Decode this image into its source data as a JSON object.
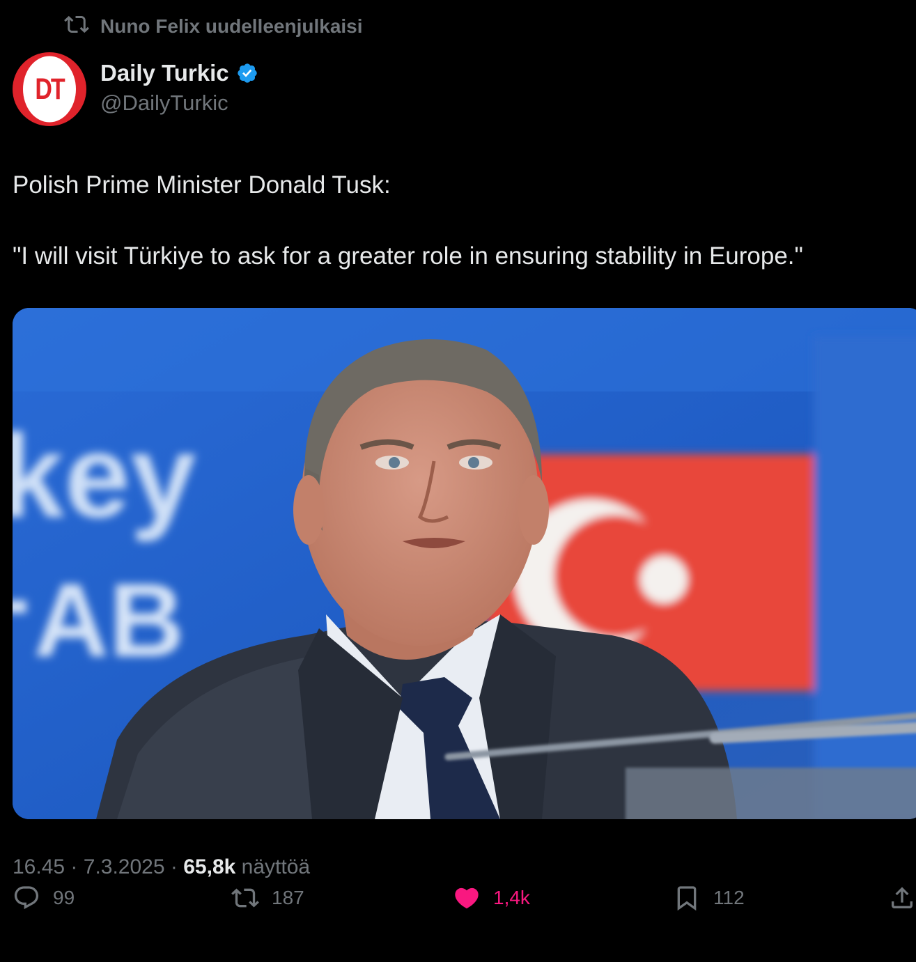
{
  "retweet": {
    "label": "Nuno Felix uudelleenjulkaisi"
  },
  "author": {
    "avatar_text": "DT",
    "display_name": "Daily Turkic",
    "handle": "@DailyTurkic",
    "verified": true
  },
  "tweet": {
    "paragraphs": [
      "Polish Prime Minister Donald Tusk:",
      "\"I will visit Türkiye to ask for a greater role in ensuring stability in Europe.\""
    ]
  },
  "media": {
    "visible_text": [
      "key",
      "AB"
    ]
  },
  "meta": {
    "time": "16.45",
    "date": "7.3.2025",
    "separator": "·",
    "views_count": "65,8k",
    "views_label": "näyttöä"
  },
  "actions": {
    "replies": "99",
    "reposts": "187",
    "likes": "1,4k",
    "bookmarks": "112"
  },
  "colors": {
    "background": "#000000",
    "secondary_text": "#71767b",
    "primary_text": "#e7e9ea",
    "like_pink": "#f91880",
    "verified_blue": "#1d9bf0",
    "brand_red": "#e0232b"
  }
}
